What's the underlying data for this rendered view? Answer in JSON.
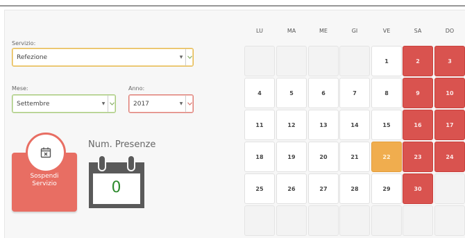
{
  "colors": {
    "accent_red": "#d9534f",
    "accent_orange": "#f0ad4e",
    "button_red": "#e86e63",
    "count_green": "#2d8a2d"
  },
  "servizio": {
    "label": "Servizio:",
    "value": "Refezione"
  },
  "mese": {
    "label": "Mese:",
    "value": "Settembre"
  },
  "anno": {
    "label": "Anno:",
    "value": "2017"
  },
  "suspend": {
    "icon": "calendar-x-icon",
    "label_line1": "Sospendi",
    "label_line2": "Servizio"
  },
  "presenze": {
    "title": "Num. Presenze",
    "icon": "calendar-icon",
    "count": "0"
  },
  "calendar": {
    "headers": [
      "LU",
      "MA",
      "ME",
      "GI",
      "VE",
      "SA",
      "DO"
    ],
    "weeks": [
      [
        {
          "day": "",
          "status": "empty"
        },
        {
          "day": "",
          "status": "empty"
        },
        {
          "day": "",
          "status": "empty"
        },
        {
          "day": "",
          "status": "empty"
        },
        {
          "day": "1",
          "status": "normal"
        },
        {
          "day": "2",
          "status": "red"
        },
        {
          "day": "3",
          "status": "red"
        }
      ],
      [
        {
          "day": "4",
          "status": "normal"
        },
        {
          "day": "5",
          "status": "normal"
        },
        {
          "day": "6",
          "status": "normal"
        },
        {
          "day": "7",
          "status": "normal"
        },
        {
          "day": "8",
          "status": "normal"
        },
        {
          "day": "9",
          "status": "red"
        },
        {
          "day": "10",
          "status": "red"
        }
      ],
      [
        {
          "day": "11",
          "status": "normal"
        },
        {
          "day": "12",
          "status": "normal"
        },
        {
          "day": "13",
          "status": "normal"
        },
        {
          "day": "14",
          "status": "normal"
        },
        {
          "day": "15",
          "status": "normal"
        },
        {
          "day": "16",
          "status": "red"
        },
        {
          "day": "17",
          "status": "red"
        }
      ],
      [
        {
          "day": "18",
          "status": "normal"
        },
        {
          "day": "19",
          "status": "normal"
        },
        {
          "day": "20",
          "status": "normal"
        },
        {
          "day": "21",
          "status": "normal"
        },
        {
          "day": "22",
          "status": "orange"
        },
        {
          "day": "23",
          "status": "red"
        },
        {
          "day": "24",
          "status": "red"
        }
      ],
      [
        {
          "day": "25",
          "status": "normal"
        },
        {
          "day": "26",
          "status": "normal"
        },
        {
          "day": "27",
          "status": "normal"
        },
        {
          "day": "28",
          "status": "normal"
        },
        {
          "day": "29",
          "status": "normal"
        },
        {
          "day": "30",
          "status": "red"
        },
        {
          "day": "",
          "status": "empty"
        }
      ],
      [
        {
          "day": "",
          "status": "empty"
        },
        {
          "day": "",
          "status": "empty"
        },
        {
          "day": "",
          "status": "empty"
        },
        {
          "day": "",
          "status": "empty"
        },
        {
          "day": "",
          "status": "empty"
        },
        {
          "day": "",
          "status": "empty"
        },
        {
          "day": "",
          "status": "empty"
        }
      ]
    ]
  }
}
